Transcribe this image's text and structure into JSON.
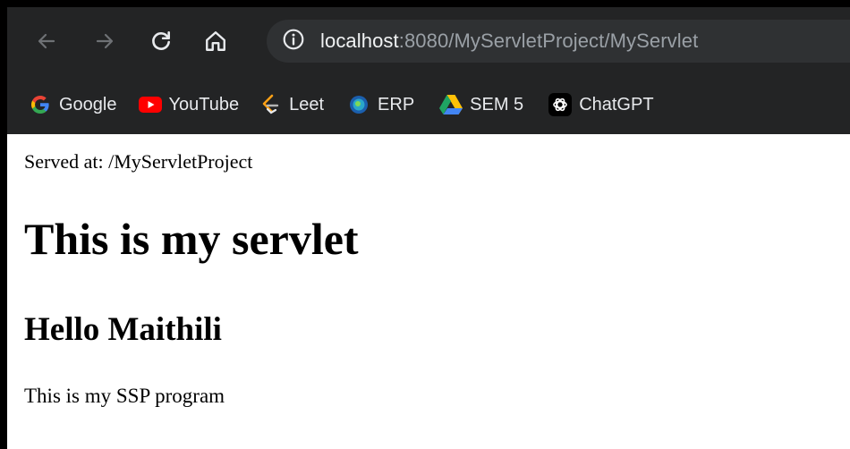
{
  "browser": {
    "address_bar": {
      "host": "localhost",
      "rest": ":8080/MyServletProject/MyServlet"
    },
    "bookmarks": [
      {
        "label": "Google",
        "icon": "google-icon"
      },
      {
        "label": "YouTube",
        "icon": "youtube-icon"
      },
      {
        "label": "Leet",
        "icon": "leetcode-icon"
      },
      {
        "label": "ERP",
        "icon": "erp-icon"
      },
      {
        "label": "SEM 5",
        "icon": "google-drive-icon"
      },
      {
        "label": "ChatGPT",
        "icon": "chatgpt-icon"
      }
    ],
    "colors": {
      "toolbar_bg": "#232425",
      "omnibox_bg": "#2f3133",
      "url_host": "#f1f3f4",
      "url_rest": "#9aa0a6"
    }
  },
  "page": {
    "served_at": "Served at: /MyServletProject",
    "heading1": "This is my servlet",
    "heading2": "Hello Maithili",
    "paragraph": "This is my SSP program"
  }
}
